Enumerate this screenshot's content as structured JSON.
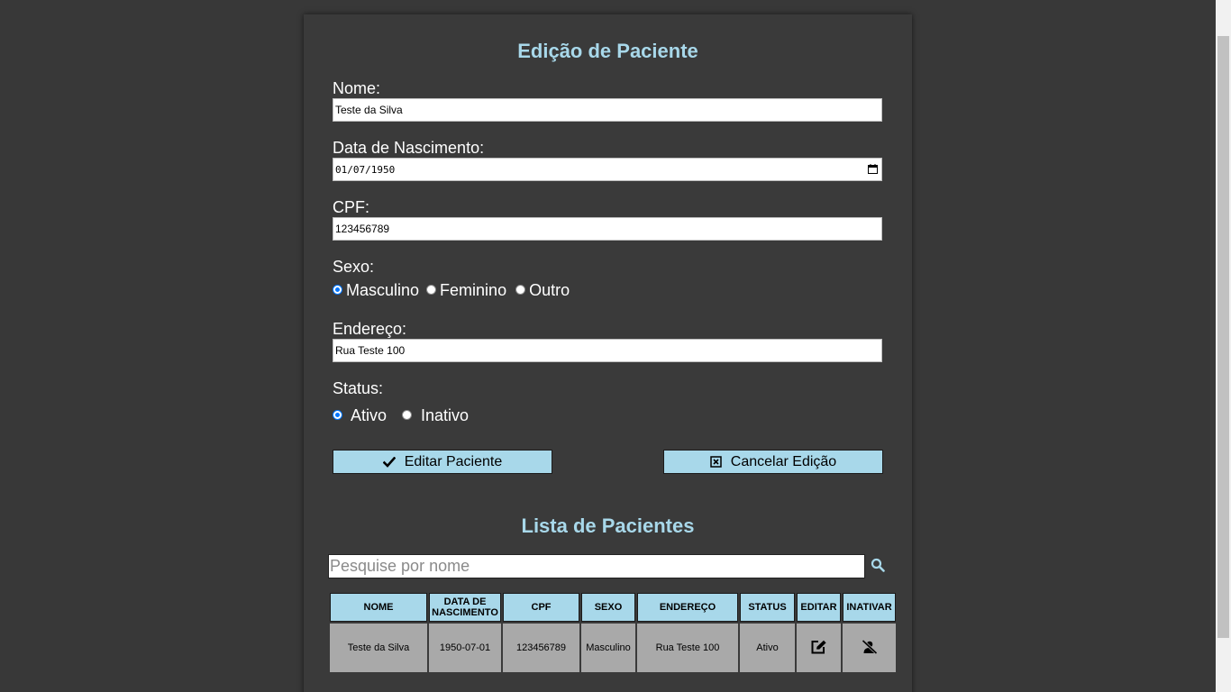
{
  "form": {
    "title": "Edição de Paciente",
    "nome_label": "Nome:",
    "nome_value": "Teste da Silva",
    "nascimento_label": "Data de Nascimento:",
    "nascimento_value": "01/07/1950",
    "cpf_label": "CPF:",
    "cpf_value": "123456789",
    "sexo_label": "Sexo:",
    "sexo_options": [
      "Masculino",
      "Feminino",
      "Outro"
    ],
    "sexo_selected": "Masculino",
    "endereco_label": "Endereço:",
    "endereco_value": "Rua Teste 100",
    "status_label": "Status:",
    "status_options": [
      "Ativo",
      "Inativo"
    ],
    "status_selected": "Ativo",
    "submit_label": "Editar Paciente",
    "cancel_label": "Cancelar Edição"
  },
  "list": {
    "title": "Lista de Pacientes",
    "search_placeholder": "Pesquise por nome",
    "columns": [
      "NOME",
      "DATA DE NASCIMENTO",
      "CPF",
      "SEXO",
      "ENDEREÇO",
      "STATUS",
      "EDITAR",
      "INATIVAR"
    ],
    "rows": [
      {
        "nome": "Teste da Silva",
        "nascimento": "1950-07-01",
        "cpf": "123456789",
        "sexo": "Masculino",
        "endereco": "Rua Teste 100",
        "status": "Ativo",
        "edit_icon": "edit-icon",
        "deactivate_icon": "user-slash-icon"
      }
    ]
  },
  "colors": {
    "background": "#383838",
    "accent": "#a8d8ea",
    "row_background": "#a9a9a9",
    "radio_checked": "#0075ff"
  },
  "icons": {
    "submit": "check-icon",
    "cancel": "square-x-icon",
    "search": "search-icon",
    "date_picker": "calendar-icon"
  }
}
